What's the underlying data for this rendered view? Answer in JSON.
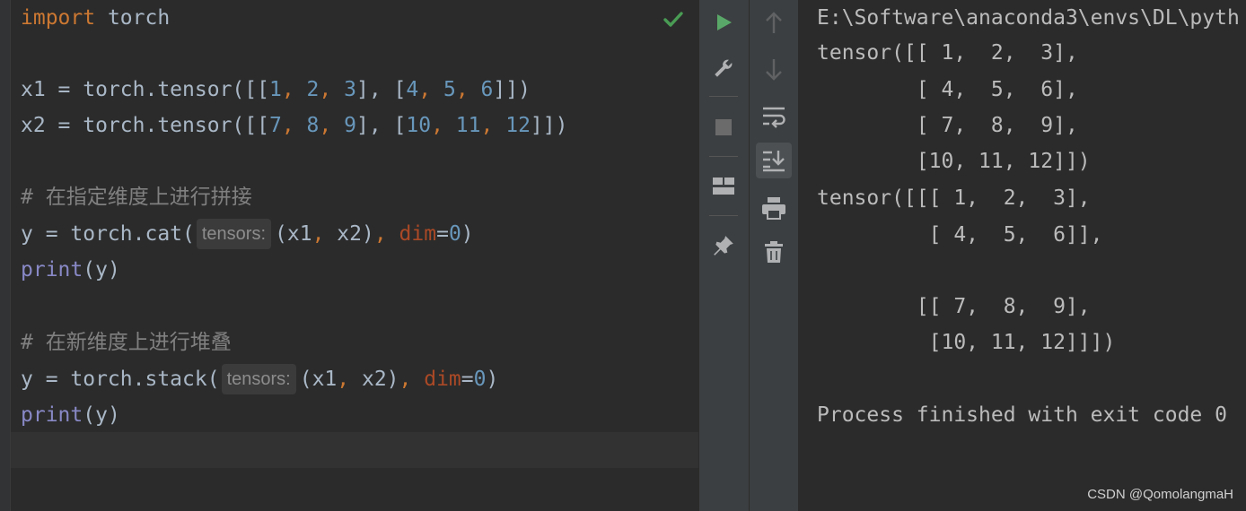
{
  "editor": {
    "line1": {
      "kw": "import",
      "rest": " torch"
    },
    "line3": {
      "var": "x1",
      "eq": " = ",
      "call": "torch.tensor",
      "open": "([[",
      "n1": "1",
      "n2": "2",
      "n3": "3",
      "mid": "], [",
      "n4": "4",
      "n5": "5",
      "n6": "6",
      "close": "]])"
    },
    "line4": {
      "var": "x2",
      "eq": " = ",
      "call": "torch.tensor",
      "open": "([[",
      "n1": "7",
      "n2": "8",
      "n3": "9",
      "mid": "], [",
      "n4": "10",
      "n5": "11",
      "n6": "12",
      "close": "]])"
    },
    "line6": {
      "comment": "# 在指定维度上进行拼接"
    },
    "line7": {
      "pre": "y = torch.cat(",
      "hint": "tensors:",
      "args": "(x1",
      "comma": ",",
      "args2": " x2)",
      "comma2": ",",
      "param": " dim",
      "eq": "=",
      "num": "0",
      "close": ")"
    },
    "line8": {
      "builtin": "print",
      "rest": "(y)"
    },
    "line10": {
      "comment": "# 在新维度上进行堆叠"
    },
    "line11": {
      "pre": "y = torch.stack(",
      "hint": "tensors:",
      "args": "(x1",
      "comma": ",",
      "args2": " x2)",
      "comma2": ",",
      "param": " dim",
      "eq": "=",
      "num": "0",
      "close": ")"
    },
    "line12": {
      "builtin": "print",
      "rest": "(y)"
    }
  },
  "toolbar": {
    "left": [
      "run-icon",
      "wrench-icon",
      "stop-icon",
      "layout-icon",
      "pin-icon"
    ],
    "right": [
      "arrow-up-icon",
      "arrow-down-icon",
      "soft-wrap-icon",
      "scroll-to-end-icon",
      "print-icon",
      "trash-icon"
    ]
  },
  "console": {
    "lines": [
      "E:\\Software\\anaconda3\\envs\\DL\\pyth",
      "tensor([[ 1,  2,  3],",
      "        [ 4,  5,  6],",
      "        [ 7,  8,  9],",
      "        [10, 11, 12]])",
      "tensor([[[ 1,  2,  3],",
      "         [ 4,  5,  6]],",
      "",
      "        [[ 7,  8,  9],",
      "         [10, 11, 12]]])",
      "",
      "Process finished with exit code 0"
    ]
  },
  "watermark": "CSDN @QomolangmaH",
  "colors": {
    "keyword": "#cc7832",
    "number": "#6897bb",
    "comment": "#808080",
    "builtin": "#8888c6",
    "param": "#aa4926",
    "text": "#a9b7c6",
    "run_green": "#59a869",
    "check_green": "#499c54"
  }
}
